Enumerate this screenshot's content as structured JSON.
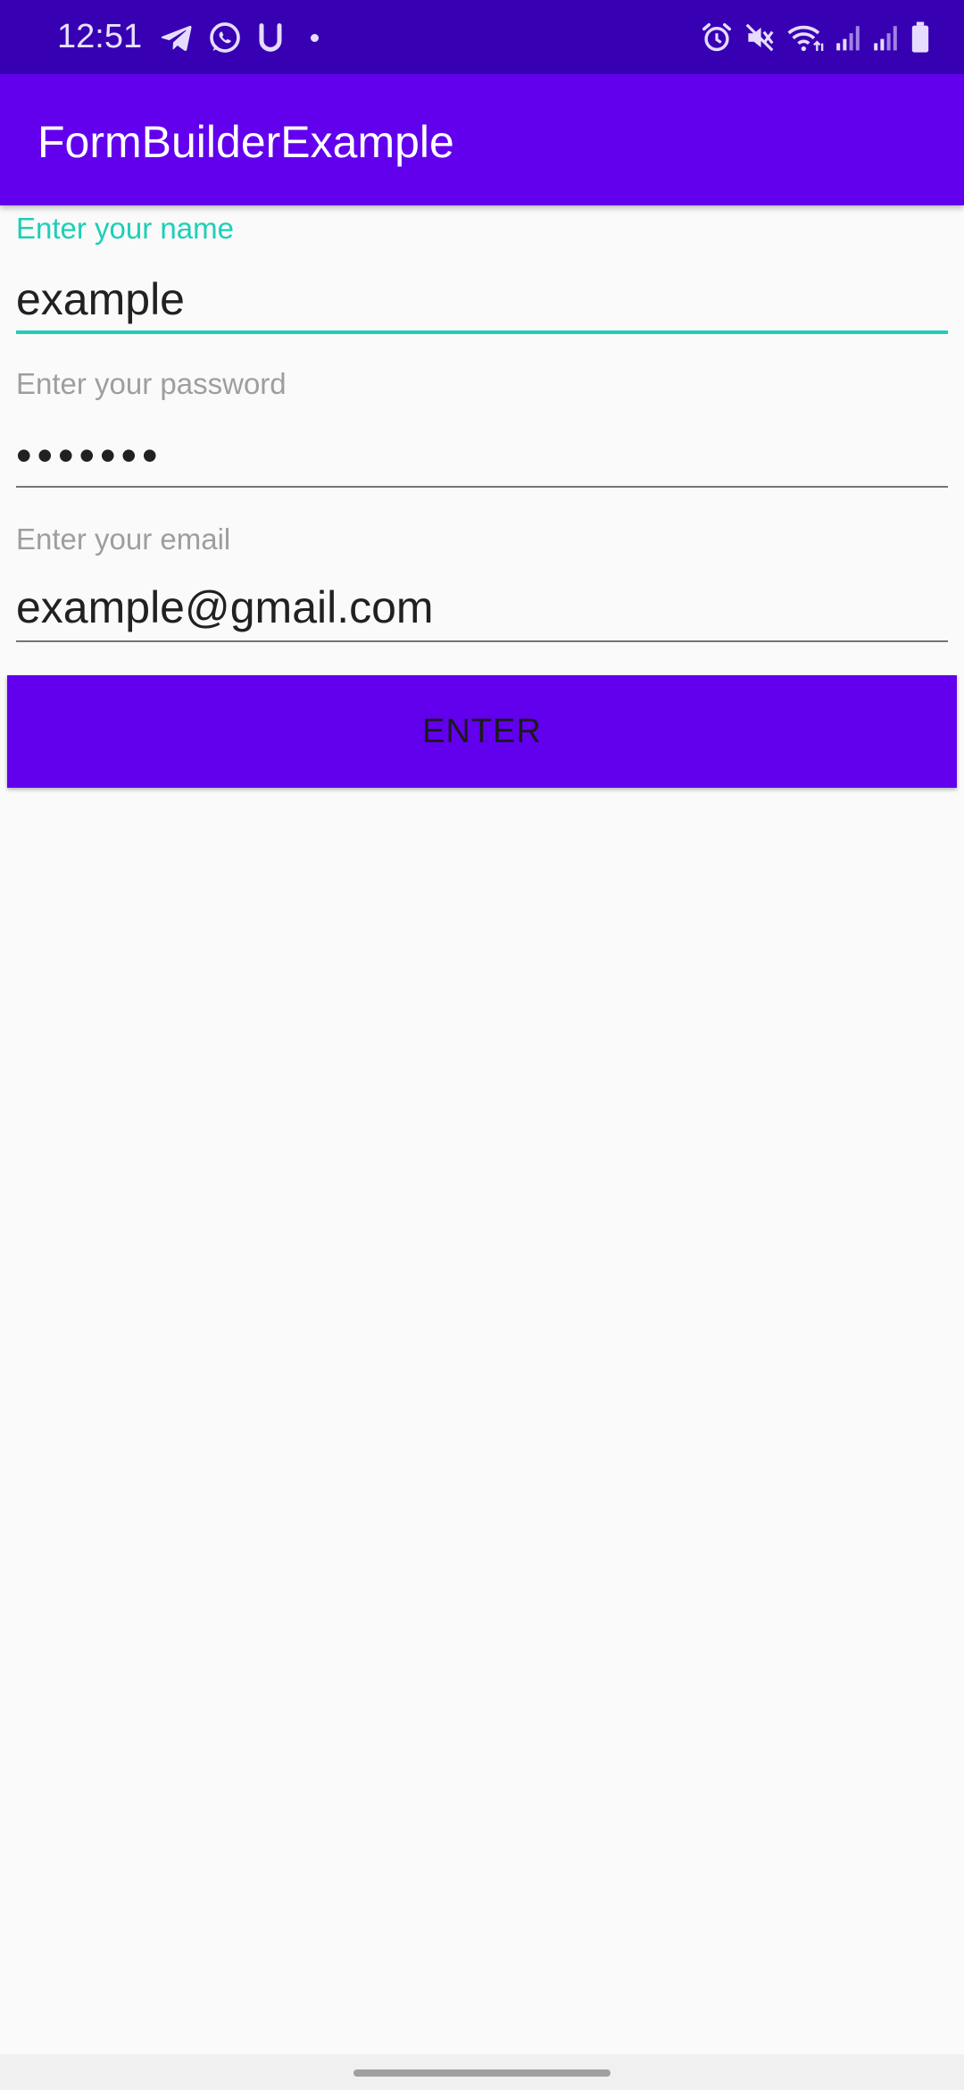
{
  "status_bar": {
    "time": "12:51",
    "left_icons": [
      "telegram-icon",
      "whatsapp-icon",
      "u-app-icon",
      "notification-dot-icon"
    ],
    "right_icons": [
      "alarm-icon",
      "mute-icon",
      "wifi-icon",
      "signal-icon",
      "signal-icon",
      "battery-icon"
    ]
  },
  "app_bar": {
    "title": "FormBuilderExample",
    "color": "#6200ee"
  },
  "form": {
    "name": {
      "label": "Enter your name",
      "value": "example",
      "focused": true
    },
    "password": {
      "label": "Enter your password",
      "value": "•••••••"
    },
    "email": {
      "label": "Enter your email",
      "value": "example@gmail.com"
    },
    "submit": {
      "label": "ENTER"
    }
  },
  "colors": {
    "status_bar": "#3700b3",
    "primary": "#6200ee",
    "accent": "#1ccfb7",
    "background": "#fafafa"
  }
}
